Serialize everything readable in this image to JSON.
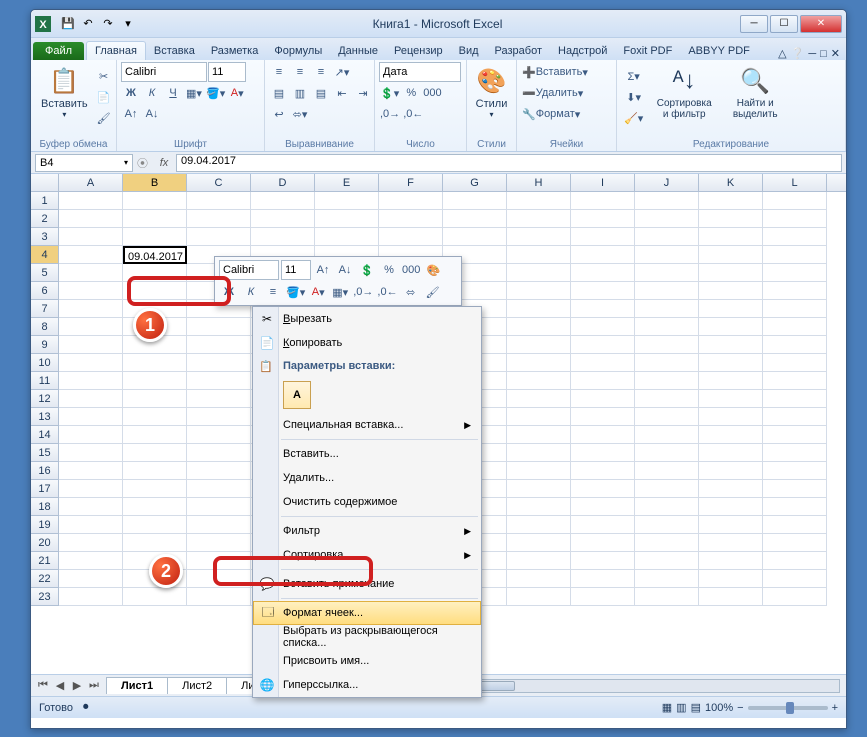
{
  "window": {
    "title": "Книга1 - Microsoft Excel"
  },
  "tabs": {
    "file": "Файл",
    "items": [
      "Главная",
      "Вставка",
      "Разметка",
      "Формулы",
      "Данные",
      "Рецензир",
      "Вид",
      "Разработ",
      "Надстрой",
      "Foxit PDF",
      "ABBYY PDF"
    ]
  },
  "ribbon": {
    "clipboard_label": "Буфер обмена",
    "paste": "Вставить",
    "font_label": "Шрифт",
    "font_name": "Calibri",
    "font_size": "11",
    "align_label": "Выравнивание",
    "number_label": "Число",
    "number_format": "Дата",
    "styles_label": "Стили",
    "styles": "Стили",
    "cells_label": "Ячейки",
    "insert": "Вставить",
    "delete": "Удалить",
    "format": "Формат",
    "edit_label": "Редактирование",
    "sort": "Сортировка и фильтр",
    "find": "Найти и выделить"
  },
  "formula_bar": {
    "name": "B4",
    "value": "09.04.2017"
  },
  "columns": [
    "A",
    "B",
    "C",
    "D",
    "E",
    "F",
    "G",
    "H",
    "I",
    "J",
    "K",
    "L"
  ],
  "rows": [
    "1",
    "2",
    "3",
    "4",
    "5",
    "6",
    "7",
    "8",
    "9",
    "10",
    "11",
    "12",
    "13",
    "14",
    "15",
    "16",
    "17",
    "18",
    "19",
    "20",
    "21",
    "22",
    "23"
  ],
  "cell_b4": "09.04.2017",
  "mini": {
    "font": "Calibri",
    "size": "11"
  },
  "context": {
    "cut": "Вырезать",
    "copy": "Копировать",
    "paste_options": "Параметры вставки:",
    "paste_special": "Специальная вставка...",
    "insert": "Вставить...",
    "delete": "Удалить...",
    "clear": "Очистить содержимое",
    "filter": "Фильтр",
    "sort": "Сортировка",
    "comment": "Вставить примечание",
    "format_cells": "Формат ячеек...",
    "dropdown_list": "Выбрать из раскрывающегося списка...",
    "define_name": "Присвоить имя...",
    "hyperlink": "Гиперссылка..."
  },
  "sheets": {
    "s1": "Лист1",
    "s2": "Лист2",
    "s3": "Лист3"
  },
  "status": {
    "ready": "Готово",
    "zoom": "100%"
  },
  "annotations": {
    "b1": "1",
    "b2": "2"
  }
}
